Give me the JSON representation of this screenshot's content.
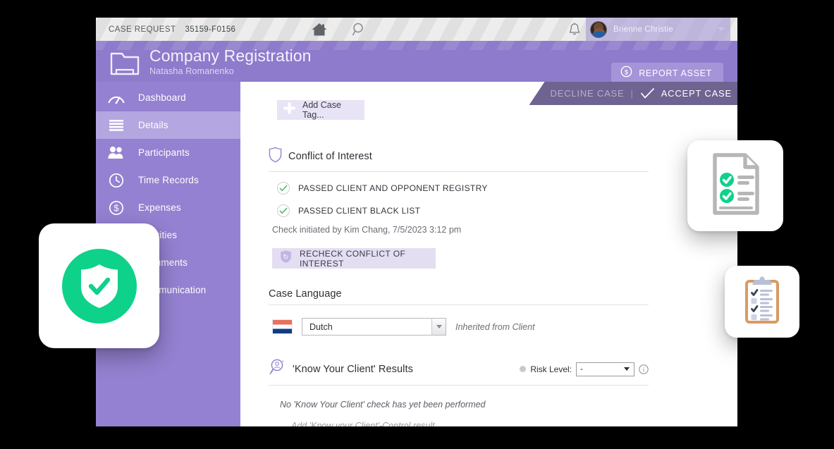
{
  "topbar": {
    "breadcrumb_label": "CASE REQUEST",
    "case_number": "35159-F0156",
    "home_icon": "home-icon",
    "search_icon": "search-icon",
    "bell_icon": "bell-icon",
    "user_name": "Brienne Christie",
    "caret_icon": "chevron-down-icon"
  },
  "header": {
    "folder_icon": "folder-icon",
    "title": "Company Registration",
    "subtitle": "Natasha Romanenko",
    "report_asset_label": "REPORT ASSET",
    "report_asset_icon": "dollar-circle-icon"
  },
  "ribbon": {
    "decline_label": "DECLINE CASE",
    "separator": "|",
    "accept_label": "ACCEPT CASE",
    "accept_icon": "check-icon"
  },
  "sidebar": {
    "items": [
      {
        "label": "Dashboard",
        "icon": "gauge-icon",
        "active": false
      },
      {
        "label": "Details",
        "icon": "list-lines-icon",
        "active": true
      },
      {
        "label": "Participants",
        "icon": "people-icon",
        "active": false
      },
      {
        "label": "Time Records",
        "icon": "clock-icon",
        "active": false
      },
      {
        "label": "Expenses",
        "icon": "dollar-circle-icon",
        "active": false
      },
      {
        "label": "Activities",
        "icon": "activities-icon",
        "active": false
      },
      {
        "label": "Documents",
        "icon": "documents-icon",
        "active": false
      },
      {
        "label": "Communication",
        "icon": "communication-icon",
        "active": false
      }
    ]
  },
  "content": {
    "add_case_tag_label": "Add Case Tag...",
    "add_case_tag_icon": "plus-icon",
    "conflict": {
      "title": "Conflict of Interest",
      "icon": "shield-outline-icon",
      "checks": [
        {
          "label": "PASSED CLIENT AND OPPONENT REGISTRY",
          "icon": "check-icon"
        },
        {
          "label": "PASSED CLIENT BLACK LIST",
          "icon": "check-icon"
        }
      ],
      "meta": "Check initiated by Kim Chang, 7/5/2023 3:12 pm",
      "recheck_label": "RECHECK CONFLICT OF INTEREST",
      "recheck_icon": "shield-refresh-icon"
    },
    "language": {
      "title": "Case Language",
      "flag_icon": "flag-netherlands-icon",
      "selected": "Dutch",
      "caret_icon": "chevron-down-icon",
      "note": "Inherited from Client"
    },
    "kyc": {
      "title": "'Know Your Client' Results",
      "icon": "kyc-magnifier-person-icon",
      "risk_label": "Risk Level:",
      "risk_value": "-",
      "risk_dot_icon": "status-dot-icon",
      "risk_caret_icon": "chevron-down-icon",
      "info_icon": "info-icon",
      "empty_text": "No 'Know Your Client' check has yet been performed",
      "add_text": "Add 'Know your Client'-Control result..."
    }
  },
  "floating_cards": [
    {
      "name": "shield-check-card",
      "icon": "shield-check-icon"
    },
    {
      "name": "document-checklist-card",
      "icon": "document-check-icon"
    },
    {
      "name": "clipboard-checklist-card",
      "icon": "clipboard-check-icon"
    }
  ],
  "colors": {
    "brand_purple": "#8e7bcc",
    "sidebar_purple": "#9481d1",
    "sidebar_active": "#b4a6e0",
    "ribbon_purple": "#6f6391",
    "accent_green": "#0ed28a",
    "check_green": "#46b56a",
    "tag_lilac": "#e8e3f5"
  }
}
